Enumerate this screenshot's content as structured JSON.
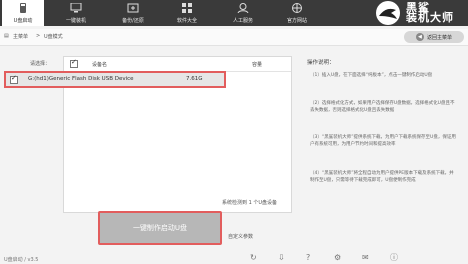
{
  "topbar": {
    "tabs": [
      {
        "label": "U盘启动",
        "active": true,
        "icon": "usb-drive-icon"
      },
      {
        "label": "一键装机",
        "active": false,
        "icon": "monitor-install-icon"
      },
      {
        "label": "备份/还原",
        "active": false,
        "icon": "backup-icon"
      },
      {
        "label": "软件大全",
        "active": false,
        "icon": "software-icon"
      },
      {
        "label": "人工服务",
        "active": false,
        "icon": "support-icon"
      },
      {
        "label": "官方网站",
        "active": false,
        "icon": "website-icon"
      }
    ],
    "logo_text": "黑鲨\n装机大师"
  },
  "crumb": {
    "home": "主菜单",
    "current": "U盘模式",
    "back_label": "返回主菜单"
  },
  "select_label": "请选择：",
  "table": {
    "col_device": "设备名",
    "col_capacity": "容量",
    "rows": [
      {
        "name": "G:(hd1)Generic Flash Disk USB Device",
        "capacity": "7.61G",
        "checked": true
      }
    ]
  },
  "detected_text": "系统检测到 1 个U盘设备",
  "make_button": "一键制作启动U盘",
  "custom_params": "自定义参数",
  "ops": {
    "title": "操作说明：",
    "items": [
      "（1）插入U盘，在下面选择“纯板本”，点击一键制作启动U盘",
      "（2）选择格式化方式，如果用户选择保存U盘数据，选择格式化U盘且不丢失数据，否则选择格式化U盘且丢失数据",
      "（3）“黑鲨装机大师”提供系统下载，为用户下载系统保存至U盘，保证用户有系统可用，为用户节约时间和提高效率",
      "（4）“黑鲨装机大师”将全程自动为用户提供PE版本下载及系统下载，并制作至U盘，只需等待下载完成即可，U盘便制作完成"
    ]
  },
  "footer": {
    "left": "U盘启动 / v3.5"
  }
}
